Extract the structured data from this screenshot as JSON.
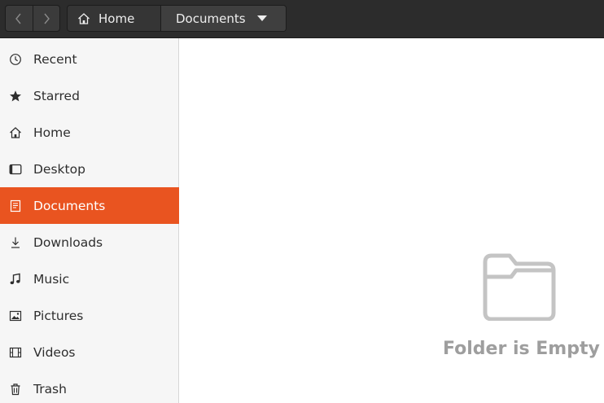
{
  "header": {
    "back_icon": "chevron-left-icon",
    "forward_icon": "chevron-right-icon",
    "breadcrumb": [
      {
        "label": "Home",
        "icon": "home-icon"
      },
      {
        "label": "Documents",
        "icon": "chevron-down-icon"
      }
    ]
  },
  "sidebar": {
    "items": [
      {
        "label": "Recent",
        "icon": "clock-icon"
      },
      {
        "label": "Starred",
        "icon": "star-icon"
      },
      {
        "label": "Home",
        "icon": "home-icon"
      },
      {
        "label": "Desktop",
        "icon": "desktop-icon"
      },
      {
        "label": "Documents",
        "icon": "document-icon",
        "active": true
      },
      {
        "label": "Downloads",
        "icon": "download-icon"
      },
      {
        "label": "Music",
        "icon": "music-icon"
      },
      {
        "label": "Pictures",
        "icon": "picture-icon"
      },
      {
        "label": "Videos",
        "icon": "video-icon"
      },
      {
        "label": "Trash",
        "icon": "trash-icon"
      }
    ]
  },
  "main": {
    "empty_icon": "folder-icon",
    "empty_label": "Folder is Empty"
  },
  "colors": {
    "accent": "#e95420",
    "headerbar": "#2c2c2c",
    "sidebar": "#f6f6f6"
  }
}
